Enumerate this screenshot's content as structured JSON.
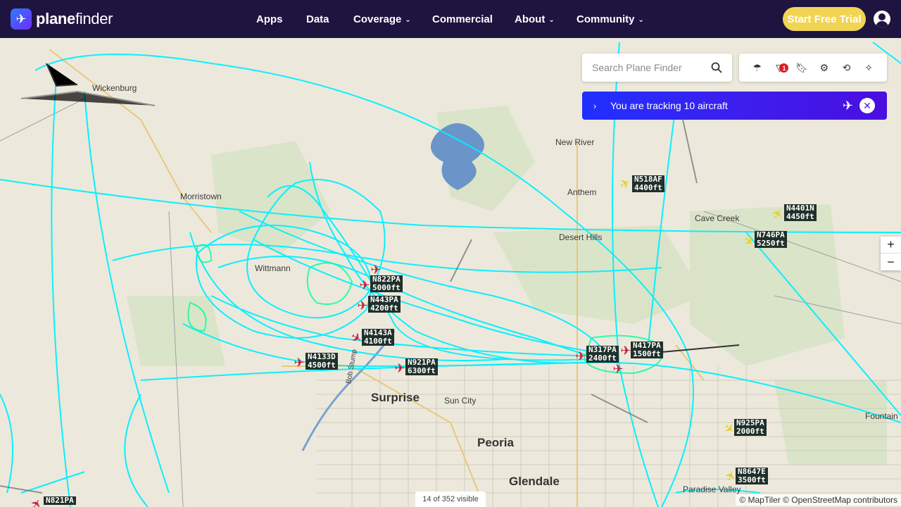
{
  "header": {
    "brand_bold": "plane",
    "brand_rest": "finder",
    "nav": [
      {
        "label": "Apps"
      },
      {
        "label": "Data"
      },
      {
        "label": "Coverage"
      },
      {
        "label": "Commercial"
      },
      {
        "label": "About"
      },
      {
        "label": "Community"
      }
    ],
    "trial_label": "Start Free Trial"
  },
  "search": {
    "placeholder": "Search Plane Finder"
  },
  "toolbar": {
    "filter_badge": "1"
  },
  "tracking": {
    "text": "You are tracking 10 aircraft"
  },
  "zoom": {
    "in": "+",
    "out": "−"
  },
  "footer": {
    "visible": "14 of 352 visible",
    "attribution": "© MapTiler © OpenStreetMap contributors"
  },
  "places": [
    {
      "name": "Wickenburg"
    },
    {
      "name": "Morristown"
    },
    {
      "name": "Wittmann"
    },
    {
      "name": "New River"
    },
    {
      "name": "Anthem"
    },
    {
      "name": "Cave Creek"
    },
    {
      "name": "Desert Hills"
    },
    {
      "name": "Surprise"
    },
    {
      "name": "Sun City"
    },
    {
      "name": "Peoria"
    },
    {
      "name": "Glendale"
    },
    {
      "name": "Paradise Valley"
    },
    {
      "name": "Fountain"
    },
    {
      "name": "Bob Stump"
    }
  ],
  "aircraft": [
    {
      "callsign": "N518AF",
      "alt": "4400ft"
    },
    {
      "callsign": "N4401N",
      "alt": "4450ft"
    },
    {
      "callsign": "N746PA",
      "alt": "5250ft"
    },
    {
      "callsign": "N822PA",
      "alt": "5000ft"
    },
    {
      "callsign": "N443PA",
      "alt": "4200ft"
    },
    {
      "callsign": "N4143A",
      "alt": "4100ft"
    },
    {
      "callsign": "N4133D",
      "alt": "4500ft"
    },
    {
      "callsign": "N921PA",
      "alt": "6300ft"
    },
    {
      "callsign": "N317PA",
      "alt": "2400ft"
    },
    {
      "callsign": "N417PA",
      "alt": "1500ft"
    },
    {
      "callsign": "N925PA",
      "alt": "2000ft"
    },
    {
      "callsign": "N8647E",
      "alt": "3500ft"
    },
    {
      "callsign": "N821PA",
      "alt": ""
    }
  ],
  "colors": {
    "header_bg": "#1e1440",
    "trial": "#f1d454",
    "track": "#00f0ff",
    "map_bg": "#ece9dc"
  }
}
